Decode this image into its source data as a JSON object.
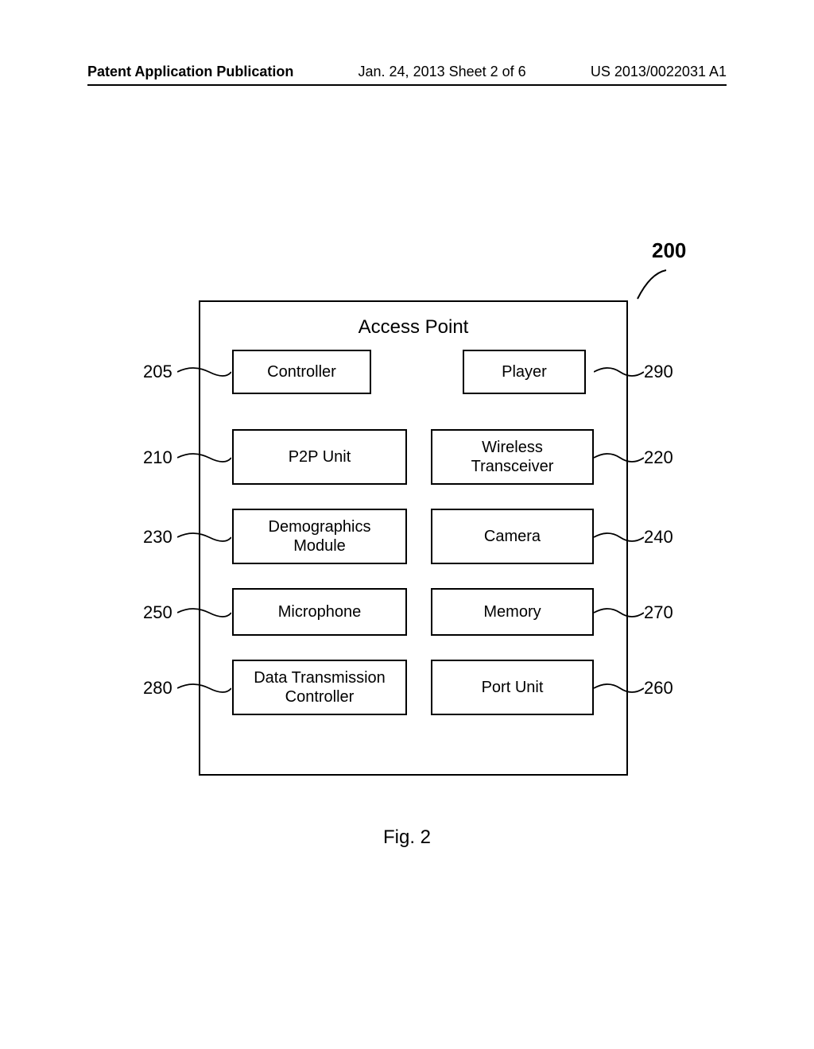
{
  "header": {
    "left": "Patent Application Publication",
    "center": "Jan. 24, 2013  Sheet 2 of 6",
    "right": "US 2013/0022031 A1"
  },
  "diagram": {
    "title": "Access Point",
    "main_ref": "200",
    "figure_label": "Fig. 2",
    "components": {
      "controller": "Controller",
      "player": "Player",
      "p2p": "P2P Unit",
      "wireless": "Wireless\nTransceiver",
      "demographics": "Demographics\nModule",
      "camera": "Camera",
      "microphone": "Microphone",
      "memory": "Memory",
      "dtc": "Data Transmission\nController",
      "port": "Port Unit"
    },
    "refs": {
      "r205": "205",
      "r210": "210",
      "r220": "220",
      "r230": "230",
      "r240": "240",
      "r250": "250",
      "r260": "260",
      "r270": "270",
      "r280": "280",
      "r290": "290"
    }
  }
}
